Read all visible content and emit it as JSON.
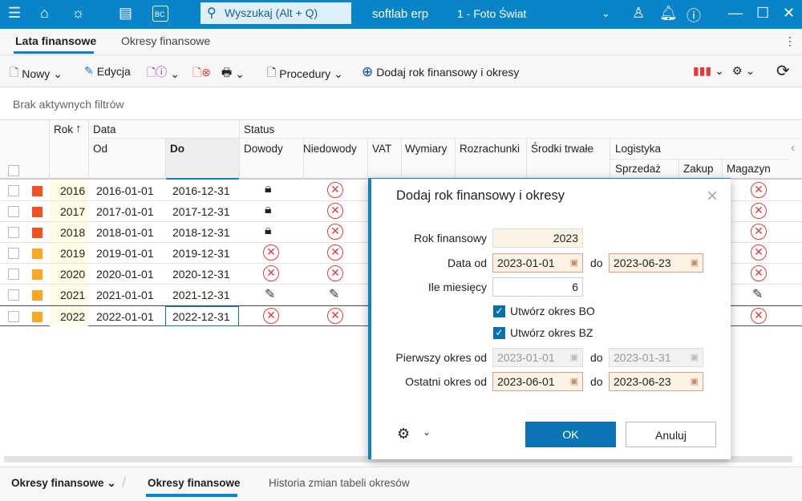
{
  "titlebar": {
    "search_placeholder": "Wyszukaj (Alt + Q)",
    "app_name": "softlab erp",
    "company": "1 - Foto Świat",
    "badge_bc": "BC"
  },
  "tabs": [
    {
      "label": "Lata finansowe",
      "active": true
    },
    {
      "label": "Okresy finansowe"
    }
  ],
  "toolbar": {
    "new": "Nowy",
    "edit": "Edycja",
    "procedures": "Procedury",
    "add_year": "Dodaj rok finansowy i okresy"
  },
  "filters": "Brak aktywnych filtrów",
  "grid": {
    "headers": {
      "rok": "Rok",
      "data": "Data",
      "od": "Od",
      "do": "Do",
      "status": "Status",
      "dowody": "Dowody",
      "niedowody": "Niedowody",
      "vat": "VAT",
      "wymiary": "Wymiary",
      "rozrachunki": "Rozrachunki",
      "srodki": "Środki trwałe",
      "logistyka": "Logistyka",
      "sprzedaz": "Sprzedaż",
      "zakup": "Zakup",
      "magazyn": "Magazyn"
    },
    "rows": [
      {
        "rok": "2016",
        "od": "2016-01-01",
        "do": "2016-12-31",
        "color": "#f4511e",
        "dowody": "lock",
        "niedowody": "closed",
        "magazyn": "closed"
      },
      {
        "rok": "2017",
        "od": "2017-01-01",
        "do": "2017-12-31",
        "color": "#f4511e",
        "dowody": "lock",
        "niedowody": "closed",
        "magazyn": "closed"
      },
      {
        "rok": "2018",
        "od": "2018-01-01",
        "do": "2018-12-31",
        "color": "#f4511e",
        "dowody": "lock",
        "niedowody": "closed",
        "magazyn": "closed"
      },
      {
        "rok": "2019",
        "od": "2019-01-01",
        "do": "2019-12-31",
        "color": "#f9a825",
        "dowody": "closed",
        "niedowody": "closed",
        "magazyn": "closed"
      },
      {
        "rok": "2020",
        "od": "2020-01-01",
        "do": "2020-12-31",
        "color": "#f9a825",
        "dowody": "closed",
        "niedowody": "closed",
        "magazyn": "closed"
      },
      {
        "rok": "2021",
        "od": "2021-01-01",
        "do": "2021-12-31",
        "color": "#f9a825",
        "dowody": "edit",
        "niedowody": "edit",
        "magazyn": "edit"
      },
      {
        "rok": "2022",
        "od": "2022-01-01",
        "do": "2022-12-31",
        "color": "#f9a825",
        "dowody": "closed",
        "niedowody": "closed",
        "magazyn": "closed"
      }
    ]
  },
  "dialog": {
    "title": "Dodaj rok finansowy i okresy",
    "rok_label": "Rok finansowy",
    "rok": "2023",
    "data_od_label": "Data od",
    "data_od": "2023-01-01",
    "do_label": "do",
    "data_do": "2023-06-23",
    "ile_label": "Ile miesięcy",
    "ile": "6",
    "bo_label": "Utwórz okres BO",
    "bz_label": "Utwórz okres BZ",
    "pierwszy_label": "Pierwszy okres od",
    "pierwszy_od": "2023-01-01",
    "pierwszy_do": "2023-01-31",
    "ostatni_label": "Ostatni okres od",
    "ostatni_od": "2023-06-01",
    "ostatni_do": "2023-06-23",
    "ok": "OK",
    "cancel": "Anuluj"
  },
  "bottom": {
    "dropdown": "Okresy finansowe",
    "tabs": [
      "Okresy finansowe",
      "Historia zmian tabeli okresów"
    ]
  }
}
